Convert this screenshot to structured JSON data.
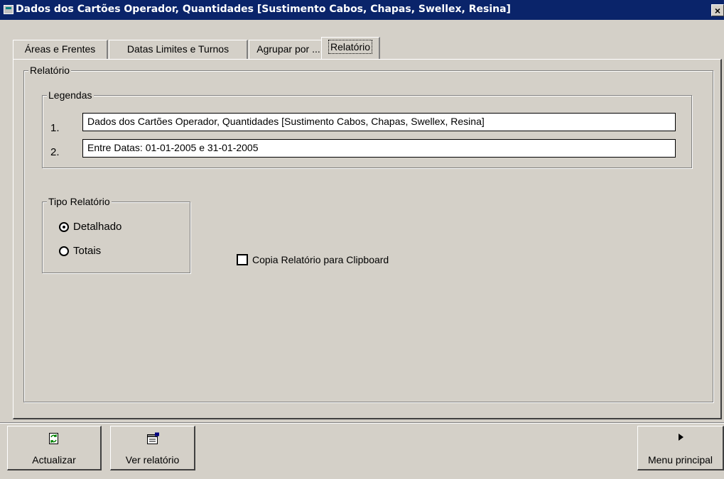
{
  "window": {
    "title": "Dados dos Cartões Operador, Quantidades [Sustimento Cabos, Chapas, Swellex, Resina]",
    "close_label": "×"
  },
  "tabs": [
    {
      "label": "Áreas e Frentes",
      "active": false
    },
    {
      "label": "Datas Limites e Turnos",
      "active": false
    },
    {
      "label": "Agrupar por ...",
      "active": false
    },
    {
      "label": "Relatório",
      "active": true
    }
  ],
  "relatorio": {
    "group_label": "Relatório",
    "legendas": {
      "group_label": "Legendas",
      "rows": [
        {
          "number": "1.",
          "value": "Dados dos Cartões Operador, Quantidades [Sustimento Cabos, Chapas, Swellex, Resina]"
        },
        {
          "number": "2.",
          "value": "Entre Datas: 01-01-2005 e 31-01-2005"
        }
      ]
    },
    "tipo": {
      "group_label": "Tipo Relatório",
      "options": [
        {
          "label": "Detalhado",
          "checked": true
        },
        {
          "label": "Totais",
          "checked": false
        }
      ]
    },
    "clipboard": {
      "label": "Copia Relatório para Clipboard",
      "checked": false
    }
  },
  "buttons": {
    "actualizar": {
      "label": "Actualizar",
      "icon": "refresh-icon"
    },
    "ver_relatorio": {
      "label": "Ver relatório",
      "icon": "report-icon"
    },
    "menu_principal": {
      "label": "Menu principal",
      "icon": "play-arrow-icon"
    }
  }
}
